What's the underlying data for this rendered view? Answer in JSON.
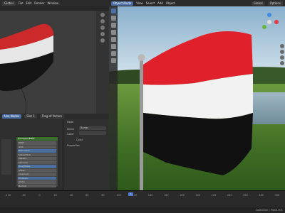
{
  "left_header": {
    "editor_label": "Global",
    "menus": [
      "File",
      "Edit",
      "Render",
      "Window"
    ]
  },
  "right_header": {
    "mode": "Object Mode",
    "menus": [
      "View",
      "Select",
      "Add",
      "Object"
    ],
    "global": "Global",
    "options": "Options"
  },
  "node_header": {
    "mode": "Use Nodes",
    "slot": "Slot 1",
    "material": "Flag of Yemen"
  },
  "node": {
    "title": "Principled BSDF",
    "rows": [
      "BSDF",
      "GGX",
      "Base Color",
      "Subsurface",
      "Metallic",
      "Specular",
      "Roughness",
      "Sheen",
      "Clearcoat",
      "Emission",
      "Alpha",
      "Normal"
    ]
  },
  "props_panel": {
    "section_node": "Node",
    "name_label": "Name",
    "name_value": "Bump",
    "label_label": "Label",
    "color_label": "Color",
    "properties_label": "Properties"
  },
  "timeline": {
    "ticks": [
      "-120",
      "-60",
      "0",
      "20",
      "40",
      "60",
      "80",
      "100",
      "120",
      "140",
      "160",
      "180",
      "200",
      "220",
      "240",
      "260",
      "280",
      "300"
    ],
    "current_frame": "1"
  },
  "status_bar": {
    "text": "Collection | Plane.001"
  },
  "colors": {
    "accent": "#4d6fa6",
    "flag_red": "#e0202a",
    "flag_white": "#f2f2f2",
    "flag_black": "#111111",
    "node_header": "#3e6e2e"
  }
}
